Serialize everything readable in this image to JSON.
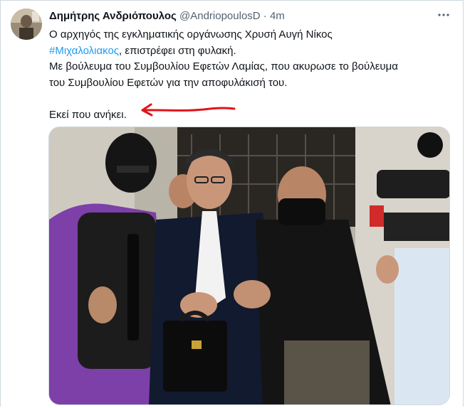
{
  "tweet": {
    "author_name": "Δημήτρης Ανδριόπουλος",
    "handle": "@AndriopoulosD",
    "separator": "·",
    "timestamp": "4m",
    "more_icon": "more-horizontal-icon",
    "lines": {
      "line1": "Ο αρχηγός της εγκληματικής οργάνωσης Χρυσή Αυγή Νίκος",
      "hashtag": "#Μιχαλολιακος",
      "line2_rest": ", επιστρέφει στη φυλακή.",
      "line3": "Με βούλευμα του Συμβουλίου Εφετών Λαμίας, που ακυρωσε το βούλευμα",
      "line4": "του Συμβουλίου Εφετών για την αποφυλάκισή του.",
      "line6": "Εκεί που ανήκει."
    },
    "colors": {
      "hashtag": "#1d9bf0",
      "arrow": "#e0141b",
      "text": "#0f1419",
      "secondary": "#536471"
    }
  }
}
